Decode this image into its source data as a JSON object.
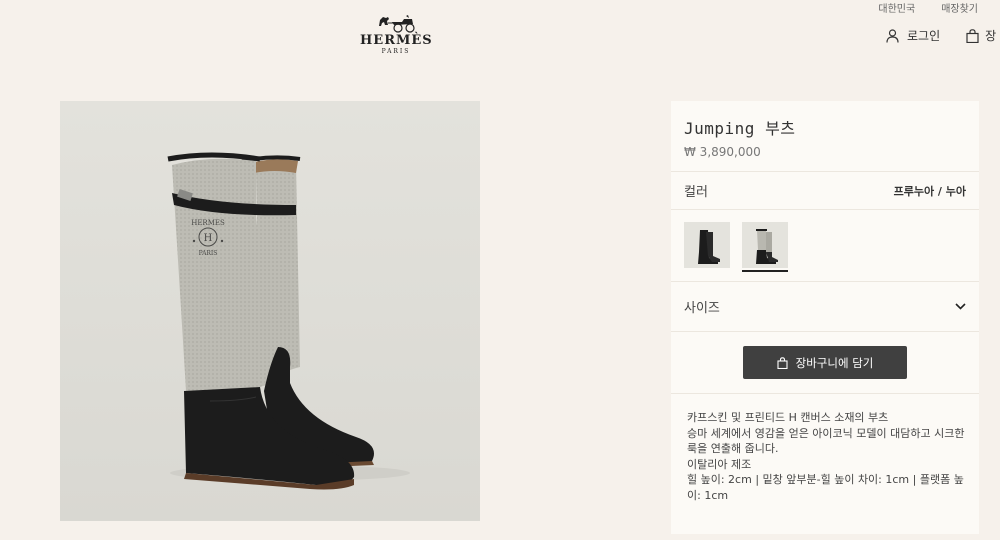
{
  "utility": {
    "region": "대한민국",
    "stores": "매장찾기"
  },
  "logo": {
    "name": "HERMÈS",
    "city": "PARIS"
  },
  "header": {
    "login_label": "로그인",
    "cart_label": "장"
  },
  "product": {
    "title": "Jumping 부츠",
    "price": "₩ 3,890,000",
    "color_label": "컬러",
    "color_value": "프루누아 / 누아",
    "size_label": "사이즈",
    "add_to_cart": "장바구니에 담기",
    "description": [
      "카프스킨 및 프린티드 H 캔버스 소재의 부츠",
      "승마 세계에서 영감을 얻은 아이코닉 모델이 대담하고 시크한 룩을 연출해 줍니다.",
      "이탈리아 제조",
      "힐 높이: 2cm | 밑창 앞부분-힐 높이 차이: 1cm | 플랫폼 높이: 1cm"
    ]
  },
  "image_text": {
    "brand": "HERMES",
    "letter": "H",
    "city": "PARIS"
  },
  "swatches": [
    {
      "name": "black",
      "selected": false
    },
    {
      "name": "canvas-black",
      "selected": true
    }
  ],
  "colors": {
    "background": "#f6f1eb",
    "panel": "#fcfaf6",
    "button": "#404040",
    "leather": "#1c1c1c",
    "canvas": "#b9b8b0"
  }
}
